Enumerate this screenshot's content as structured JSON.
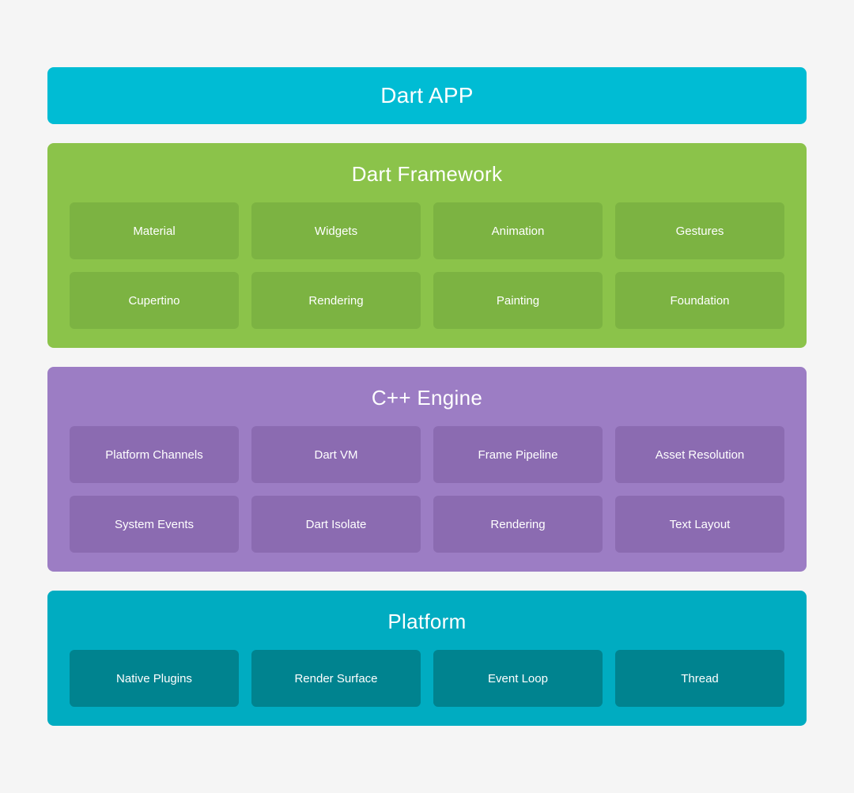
{
  "layers": {
    "dart_app": {
      "title": "Dart APP",
      "color": "#00BCD4"
    },
    "dart_framework": {
      "title": "Dart Framework",
      "color": "#8BC34A",
      "item_color": "#7CB342",
      "items": [
        "Material",
        "Widgets",
        "Animation",
        "Gestures",
        "Cupertino",
        "Rendering",
        "Painting",
        "Foundation"
      ]
    },
    "cpp_engine": {
      "title": "C++ Engine",
      "color": "#9C7DC4",
      "item_color": "#8B6BB1",
      "items": [
        "Platform Channels",
        "Dart VM",
        "Frame Pipeline",
        "Asset Resolution",
        "System Events",
        "Dart Isolate",
        "Rendering",
        "Text Layout"
      ]
    },
    "platform": {
      "title": "Platform",
      "color": "#00ACC1",
      "item_color": "#00838F",
      "items": [
        "Native Plugins",
        "Render Surface",
        "Event Loop",
        "Thread"
      ]
    }
  }
}
